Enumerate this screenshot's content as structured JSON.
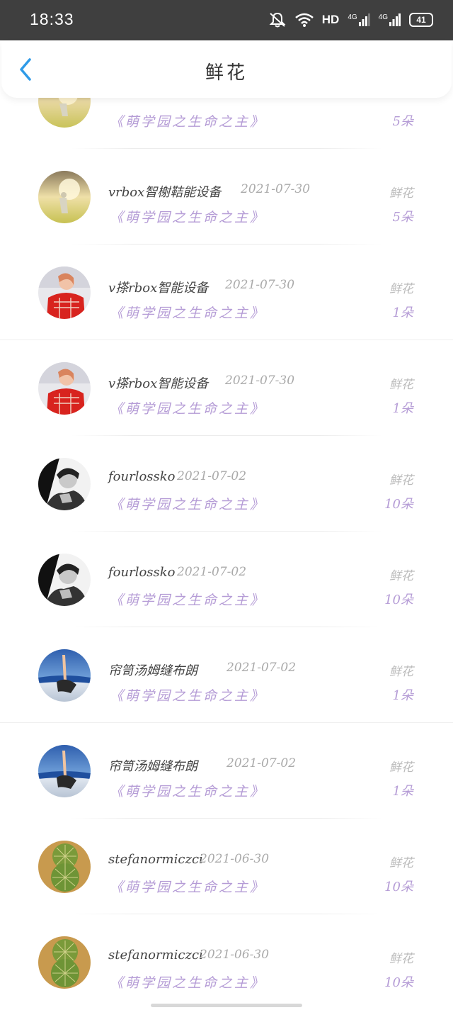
{
  "status_bar": {
    "time": "18:33",
    "network_label": "HD",
    "signal1_label": "4G",
    "signal2_label": "4G",
    "battery": "41"
  },
  "header": {
    "title": "鲜花",
    "back_icon": "chevron-left-icon"
  },
  "colors": {
    "accent": "#2f9be8",
    "source_text": "#b59cd6",
    "status_bar": "#3f3f3f"
  },
  "records": [
    {
      "name": "",
      "date": "",
      "source": "《萌学园之生命之主》",
      "gift_type": "",
      "count": "5朵",
      "avatar": "avatar-field"
    },
    {
      "name": "vrbox智榭鞊能设备",
      "date": "2021-07-30",
      "source": "《萌学园之生命之主》",
      "gift_type": "鲜花",
      "count": "5朵",
      "avatar": "avatar-field"
    },
    {
      "name": "v搽rbox智能设备",
      "date": "2021-07-30",
      "source": "《萌学园之生命之主》",
      "gift_type": "鲜花",
      "count": "1朵",
      "avatar": "avatar-girl-red"
    },
    {
      "name": "v搽rbox智能设备",
      "date": "2021-07-30",
      "source": "《萌学园之生命之主》",
      "gift_type": "鲜花",
      "count": "1朵",
      "avatar": "avatar-girl-red"
    },
    {
      "name": "fourlossko",
      "date": "2021-07-02",
      "source": "《萌学园之生命之主》",
      "gift_type": "鲜花",
      "count": "10朵",
      "avatar": "avatar-bw-man"
    },
    {
      "name": "fourlossko",
      "date": "2021-07-02",
      "source": "《萌学园之生命之主》",
      "gift_type": "鲜花",
      "count": "10朵",
      "avatar": "avatar-bw-man"
    },
    {
      "name": "帘笥汤姆缝布朗",
      "date": "2021-07-02",
      "source": "《萌学园之生命之主》",
      "gift_type": "鲜花",
      "count": "1朵",
      "avatar": "avatar-beach"
    },
    {
      "name": "帘笥汤姆缝布朗",
      "date": "2021-07-02",
      "source": "《萌学园之生命之主》",
      "gift_type": "鲜花",
      "count": "1朵",
      "avatar": "avatar-beach"
    },
    {
      "name": "stefanormiczci",
      "date": "2021-06-30",
      "source": "《萌学园之生命之主》",
      "gift_type": "鲜花",
      "count": "10朵",
      "avatar": "avatar-cactus"
    },
    {
      "name": "stefanormiczci",
      "date": "2021-06-30",
      "source": "《萌学园之生命之主》",
      "gift_type": "鲜花",
      "count": "10朵",
      "avatar": "avatar-cactus"
    }
  ]
}
